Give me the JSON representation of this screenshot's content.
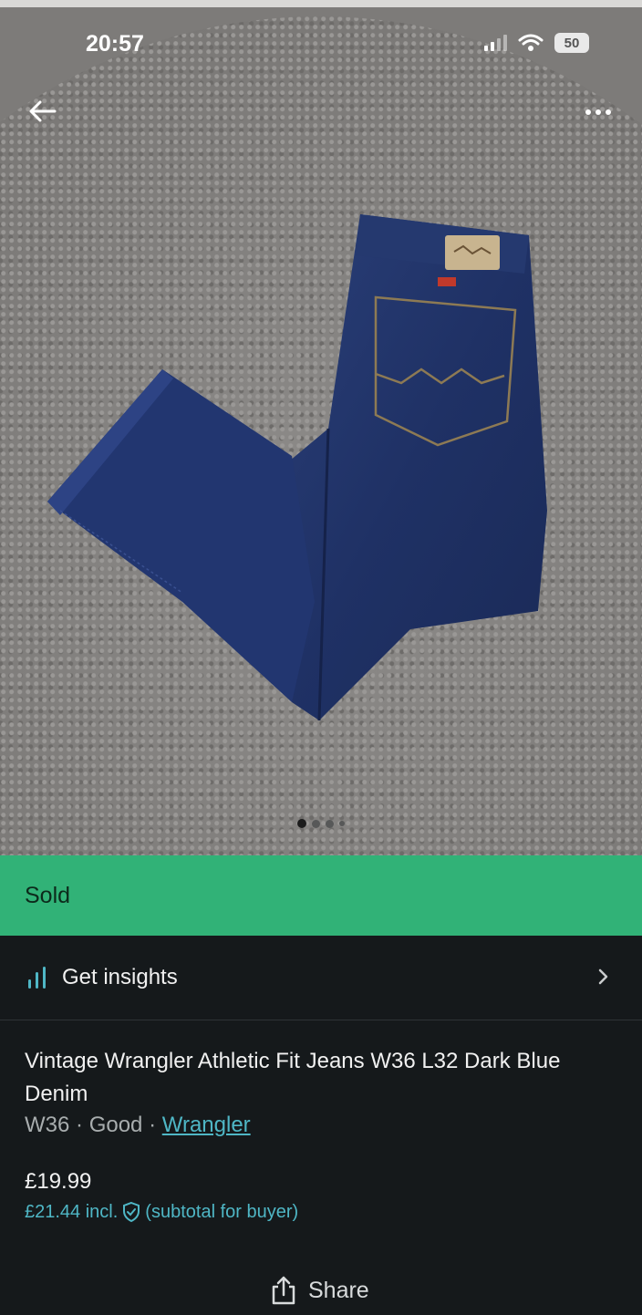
{
  "status_bar": {
    "time": "20:57",
    "battery": "50"
  },
  "photo": {
    "alt": "Dark blue Wrangler jeans on grey rug",
    "page_count": 4,
    "current_index": 0
  },
  "banner": {
    "label": "Sold",
    "color": "#31b277"
  },
  "insights": {
    "label": "Get insights"
  },
  "item": {
    "title": "Vintage Wrangler Athletic Fit Jeans W36 L32 Dark Blue Denim",
    "size": "W36",
    "condition": "Good",
    "brand": "Wrangler",
    "separator": " · ",
    "price": "£19.99",
    "price_incl": "£21.44 incl.",
    "buyer_note": "(subtotal for buyer)"
  },
  "actions": {
    "share_label": "Share"
  },
  "colors": {
    "accent": "#4fb7c6",
    "background": "#15191b"
  }
}
